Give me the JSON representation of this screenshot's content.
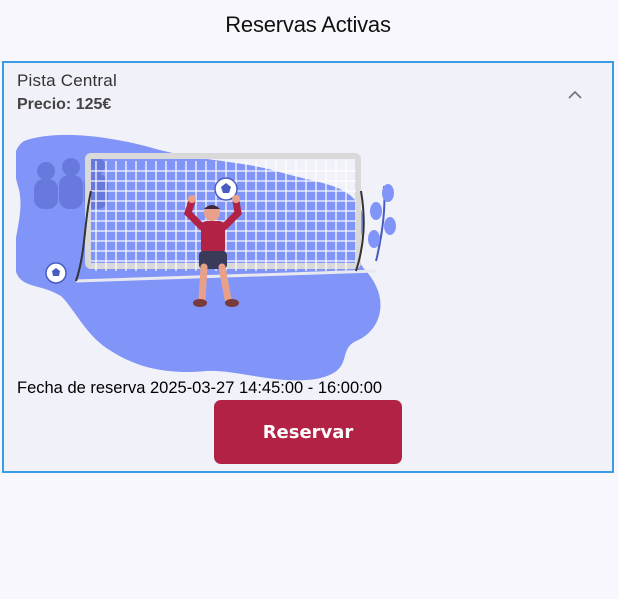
{
  "header": {
    "title": "Reservas Activas"
  },
  "reservation": {
    "court_name": "Pista Central",
    "price_label": "Precio: 125€",
    "date_line": "Fecha de reserva 2025-03-27 14:45:00 - 16:00:00",
    "button_label": "Reservar",
    "image_icon": "goalkeeper-illustration",
    "toggle_icon": "chevron-up-icon"
  },
  "colors": {
    "card_border": "#3a9de3",
    "button_bg": "#b22244",
    "blob": "#8095f7",
    "page_bg": "#f7f7fd"
  }
}
